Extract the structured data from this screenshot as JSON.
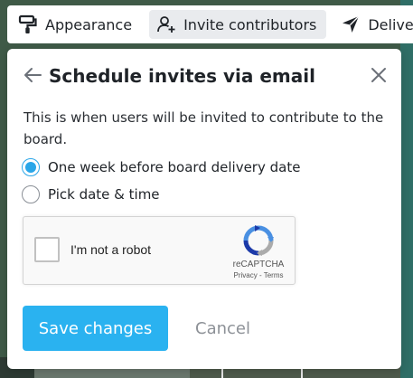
{
  "toolbar": {
    "items": [
      {
        "label": "Appearance",
        "icon": "paint-roller-icon",
        "active": false
      },
      {
        "label": "Invite contributors",
        "icon": "user-plus-icon",
        "active": true
      },
      {
        "label": "Delivery",
        "icon": "send-icon",
        "active": false
      }
    ]
  },
  "popover": {
    "title": "Schedule invites via email",
    "description": "This is when users will be invited to contribute to the board.",
    "options": [
      {
        "label": "One week before board delivery date",
        "checked": true
      },
      {
        "label": "Pick date & time",
        "checked": false
      }
    ],
    "recaptcha": {
      "label": "I'm not a robot",
      "brand": "reCAPTCHA",
      "links": "Privacy - Terms"
    },
    "save_label": "Save changes",
    "cancel_label": "Cancel"
  },
  "colors": {
    "accent": "#2ab2f0",
    "radio_checked": "#2aa6e8",
    "cancel_text": "#8d9197"
  }
}
